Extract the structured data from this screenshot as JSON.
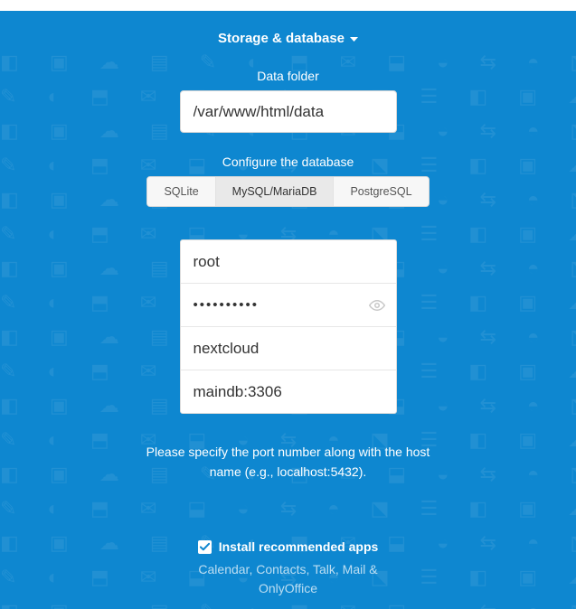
{
  "section_title": "Storage & database",
  "data_folder": {
    "label": "Data folder",
    "value": "/var/www/html/data"
  },
  "db": {
    "configure_label": "Configure the database",
    "tabs": {
      "sqlite": "SQLite",
      "mysql": "MySQL/MariaDB",
      "postgres": "PostgreSQL"
    },
    "user": "root",
    "password": "••••••••••",
    "name": "nextcloud",
    "host": "maindb:3306"
  },
  "hint": "Please specify the port number along with the host name (e.g., localhost:5432).",
  "apps": {
    "checkbox_label": "Install recommended apps",
    "list": "Calendar, Contacts, Talk, Mail & OnlyOffice"
  }
}
